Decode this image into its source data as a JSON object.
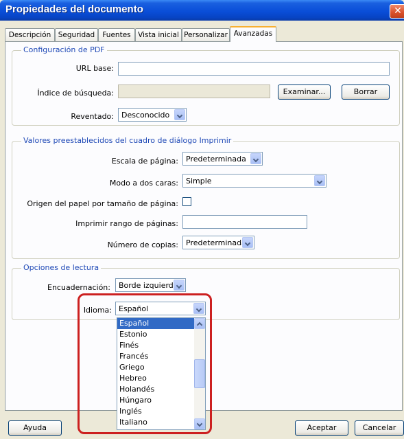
{
  "window": {
    "title": "Propiedades del documento",
    "close_icon": "close-icon"
  },
  "tabs": [
    {
      "label": "Descripción"
    },
    {
      "label": "Seguridad"
    },
    {
      "label": "Fuentes"
    },
    {
      "label": "Vista inicial"
    },
    {
      "label": "Personalizar"
    },
    {
      "label": "Avanzadas",
      "active": true
    }
  ],
  "pdf_config": {
    "legend": "Configuración de PDF",
    "url_label": "URL base:",
    "url_value": "",
    "search_index_label": "Índice de búsqueda:",
    "search_index_value": "",
    "browse_button": "Examinar...",
    "clear_button": "Borrar",
    "trapping_label": "Reventado:",
    "trapping_value": "Desconocido"
  },
  "print_presets": {
    "legend": "Valores preestablecidos del cuadro de diálogo Imprimir",
    "page_scale_label": "Escala de página:",
    "page_scale_value": "Predeterminada",
    "duplex_label": "Modo a dos caras:",
    "duplex_value": "Simple",
    "paper_source_label": "Origen del papel por tamaño de página:",
    "paper_source_checked": false,
    "page_range_label": "Imprimir rango de páginas:",
    "page_range_value": "",
    "copies_label": "Número de copias:",
    "copies_value": "Predeterminada"
  },
  "reading_options": {
    "legend": "Opciones de lectura",
    "binding_label": "Encuadernación:",
    "binding_value": "Borde izquierdo",
    "language_label": "Idioma:",
    "language_value": "Español",
    "language_options": [
      "Español",
      "Estonio",
      "Finés",
      "Francés",
      "Griego",
      "Hebreo",
      "Holandés",
      "Húngaro",
      "Inglés",
      "Italiano"
    ],
    "selected_option": "Español"
  },
  "footer": {
    "help_button": "Ayuda",
    "accept_button": "Aceptar",
    "cancel_button": "Cancelar"
  },
  "colors": {
    "title_bar": "#0a4ed8",
    "legend_text": "#1f49b6",
    "selection": "#316ac5",
    "annotation": "#cc2020"
  }
}
